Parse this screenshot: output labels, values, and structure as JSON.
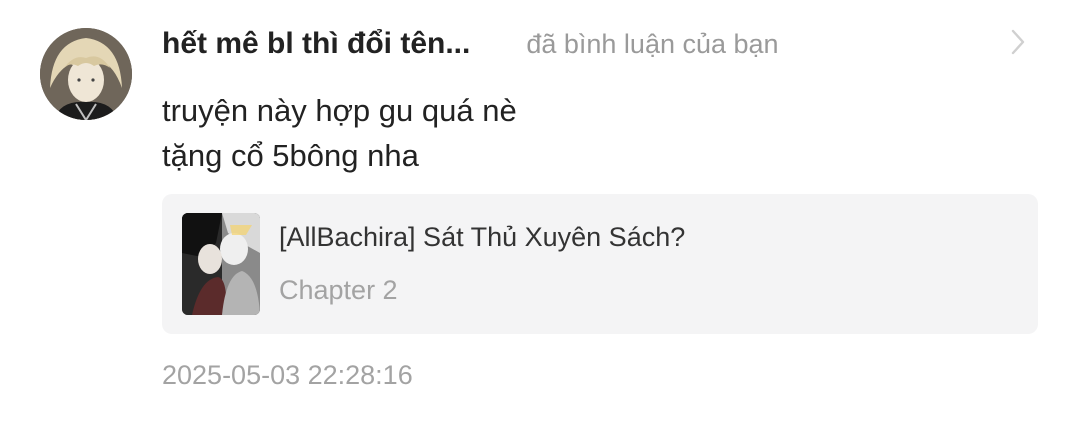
{
  "notification": {
    "username": "hết mê bl thì đổi tên...",
    "action": "đã bình luận của bạn",
    "comment_lines": [
      "truyện này hợp gu quá nè",
      "tặng cổ 5bông nha"
    ],
    "reference": {
      "title": "[AllBachira] Sát Thủ Xuyên Sách?",
      "chapter": "Chapter 2"
    },
    "timestamp": "2025-05-03 22:28:16"
  },
  "icons": {
    "avatar": "user-avatar",
    "chevron": "chevron-right-icon",
    "cover": "story-cover-thumbnail"
  },
  "colors": {
    "text_primary": "#222222",
    "text_secondary": "#9a9a9a",
    "card_background": "#f4f4f5"
  }
}
